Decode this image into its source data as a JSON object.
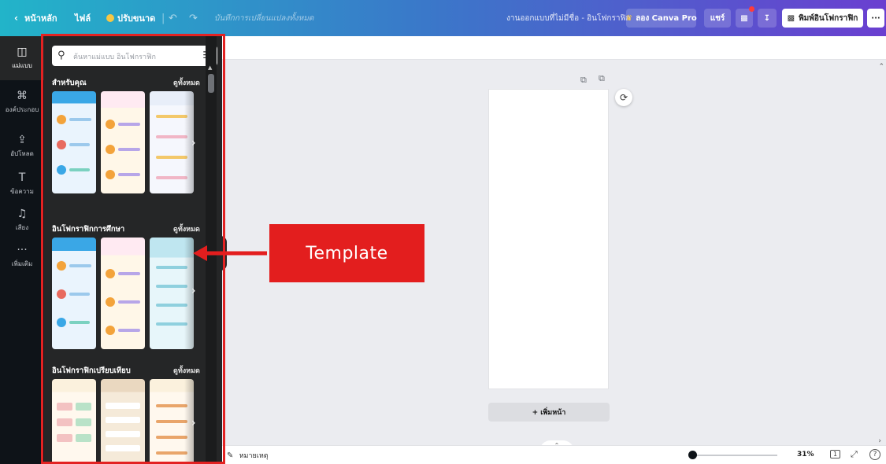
{
  "topbar": {
    "back_label": "หน้าหลัก",
    "file_label": "ไฟล์",
    "resize_label": "ปรับขนาด",
    "saved_status": "บันทึกการเปลี่ยนแปลงทั้งหมด",
    "doc_title": "งานออกแบบที่ไม่มีชื่อ - อินโฟกราฟิก",
    "try_pro_label": "ลอง Canva Pro",
    "share_label": "แชร์",
    "print_label": "พิมพ์อินโฟกราฟิก",
    "more_label": "···"
  },
  "rail": {
    "items": [
      {
        "icon": "template-icon",
        "glyph": "◫",
        "label": "แม่แบบ"
      },
      {
        "icon": "elements-icon",
        "glyph": "⌘",
        "label": "องค์ประกอบ"
      },
      {
        "icon": "upload-icon",
        "glyph": "⇪",
        "label": "อัปโหลด"
      },
      {
        "icon": "text-icon",
        "glyph": "T",
        "label": "ข้อความ"
      },
      {
        "icon": "audio-icon",
        "glyph": "♫",
        "label": "เสียง"
      },
      {
        "icon": "more-icon",
        "glyph": "···",
        "label": "เพิ่มเติม"
      }
    ]
  },
  "panel": {
    "search_placeholder": "ค้นหาแม่แบบ อินโฟกราฟิก",
    "sections": [
      {
        "title": "สำหรับคุณ",
        "see_all": "ดูทั้งหมด"
      },
      {
        "title": "อินโฟกราฟิกการศึกษา",
        "see_all": "ดูทั้งหมด"
      },
      {
        "title": "อินโฟกราฟิกเปรียบเทียบ",
        "see_all": "ดูทั้งหมด"
      }
    ]
  },
  "canvas": {
    "add_page_label": "+ เพิ่มหน้า"
  },
  "bottombar": {
    "notes_label": "หมายเหตุ",
    "zoom": "31%",
    "page_count": "1",
    "help": "?"
  },
  "annotation": {
    "callout_label": "Template",
    "color": "#e31e1e"
  }
}
